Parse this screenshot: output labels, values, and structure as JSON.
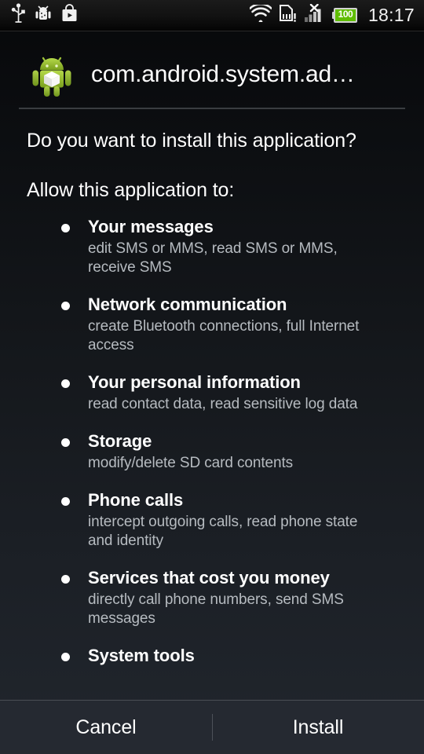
{
  "status_bar": {
    "left_icons": [
      {
        "name": "usb-icon",
        "label": "USB connected"
      },
      {
        "name": "android-debug-icon",
        "label": "USB debugging connected"
      },
      {
        "name": "play-store-icon",
        "label": "Play Store"
      }
    ],
    "right_icons": [
      {
        "name": "wifi-icon",
        "label": "Wi-Fi"
      },
      {
        "name": "sd-card-warning-icon",
        "label": "SD card"
      },
      {
        "name": "signal-no-service-icon",
        "label": "No service"
      }
    ],
    "battery": {
      "level": "100",
      "color": "#5fbd00"
    },
    "clock": "18:17"
  },
  "dialog": {
    "icon": "android-package-icon",
    "title": "com.android.system.ad…",
    "question": "Do you want to install this application?",
    "allow_label": "Allow this application to:",
    "permissions": [
      {
        "title": "Your messages",
        "description": "edit SMS or MMS, read SMS or MMS, receive SMS"
      },
      {
        "title": "Network communication",
        "description": "create Bluetooth connections, full Internet access"
      },
      {
        "title": "Your personal information",
        "description": "read contact data, read sensitive log data"
      },
      {
        "title": "Storage",
        "description": "modify/delete SD card contents"
      },
      {
        "title": "Phone calls",
        "description": "intercept outgoing calls, read phone state and identity"
      },
      {
        "title": "Services that cost you money",
        "description": "directly call phone numbers, send SMS messages"
      },
      {
        "title": "System tools",
        "description": ""
      }
    ],
    "buttons": {
      "cancel": "Cancel",
      "install": "Install"
    }
  },
  "colors": {
    "accent_green": "#a4c639",
    "battery_green": "#5fbd00",
    "description_gray": "#b6bbc0",
    "button_bar_bg": "#252931"
  }
}
